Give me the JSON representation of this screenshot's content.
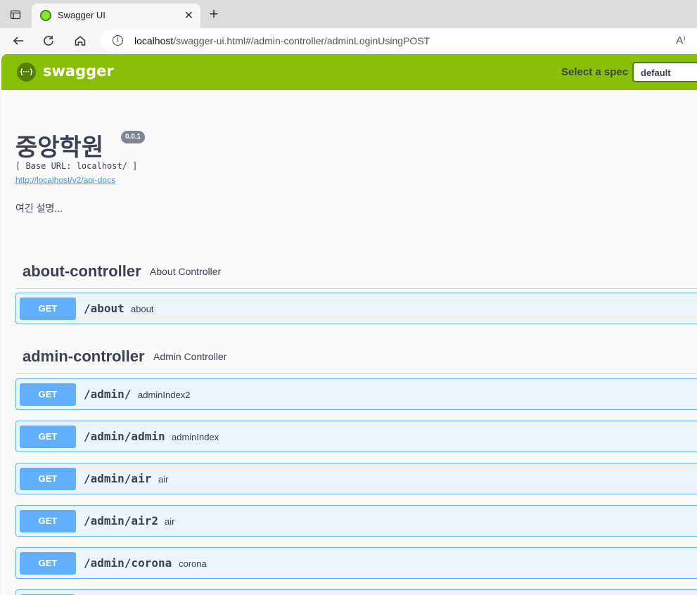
{
  "browser": {
    "tab_title": "Swagger UI",
    "tab_close": "✕",
    "new_tab": "+",
    "url_host": "localhost",
    "url_path": "/swagger-ui.html#/admin-controller/adminLoginUsingPOST",
    "read_aloud": "A⁾"
  },
  "topbar": {
    "logo_glyph": "{···}",
    "logo_text": "swagger",
    "spec_label": "Select a spec",
    "spec_value": "default"
  },
  "info": {
    "title": "중앙학원",
    "version": "0.0.1",
    "base_url": "[ Base URL: localhost/ ]",
    "api_docs_link": "http://localhost/v2/api-docs",
    "description": "여긴 설명..."
  },
  "sections": [
    {
      "name": "about-controller",
      "description": "About Controller",
      "operations": [
        {
          "method": "GET",
          "path": "/about",
          "summary": "about"
        }
      ]
    },
    {
      "name": "admin-controller",
      "description": "Admin Controller",
      "operations": [
        {
          "method": "GET",
          "path": "/admin/",
          "summary": "adminIndex2"
        },
        {
          "method": "GET",
          "path": "/admin/admin",
          "summary": "adminIndex"
        },
        {
          "method": "GET",
          "path": "/admin/air",
          "summary": "air"
        },
        {
          "method": "GET",
          "path": "/admin/air2",
          "summary": "air"
        },
        {
          "method": "GET",
          "path": "/admin/corona",
          "summary": "corona"
        }
      ]
    }
  ],
  "colors": {
    "topbar": "#89bf04",
    "get_method": "#61affe",
    "get_background": "#ebf3fb"
  }
}
